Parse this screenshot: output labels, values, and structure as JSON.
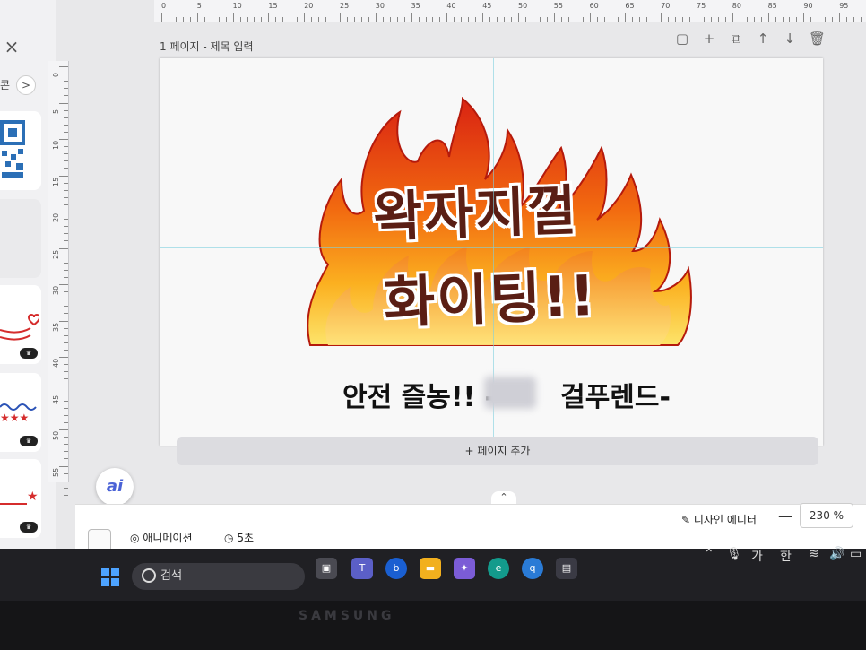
{
  "left_panel": {
    "close_glyph": "×",
    "nav_label": "콘",
    "nav_chevron": ">"
  },
  "ruler": {
    "h_labels": [
      "0",
      "5",
      "10",
      "15",
      "20",
      "25",
      "30",
      "35",
      "40",
      "45",
      "50",
      "55",
      "60",
      "65",
      "70",
      "75",
      "80",
      "85",
      "90",
      "95"
    ],
    "v_labels": [
      "0",
      "5",
      "10",
      "15",
      "20",
      "25",
      "30",
      "35",
      "40",
      "45",
      "50",
      "55"
    ]
  },
  "page": {
    "title": "1 페이지 - 제목 입력",
    "icons": [
      "page-icon",
      "add-icon",
      "duplicate-icon",
      "move-up-icon",
      "move-down-icon",
      "trash-icon"
    ]
  },
  "design": {
    "line1": "왁자지껄",
    "line2": "화이팅!!",
    "subtitle_left": "안전 즐농!! -",
    "subtitle_right": "걸푸렌드-"
  },
  "add_page_label": "+ 페이지 추가",
  "bottom_bar": {
    "animation_label": "애니메이션",
    "timer_label": "5초",
    "design_editor_label": "디자인 에디터",
    "zoom_minus": "—",
    "zoom_value": "230",
    "zoom_unit": "%"
  },
  "ai_button": "ai",
  "taskbar": {
    "search_placeholder": "검색",
    "tray_ime_1": "가",
    "tray_ime_2": "한"
  },
  "bezel_brand": "SAMSUNG"
}
